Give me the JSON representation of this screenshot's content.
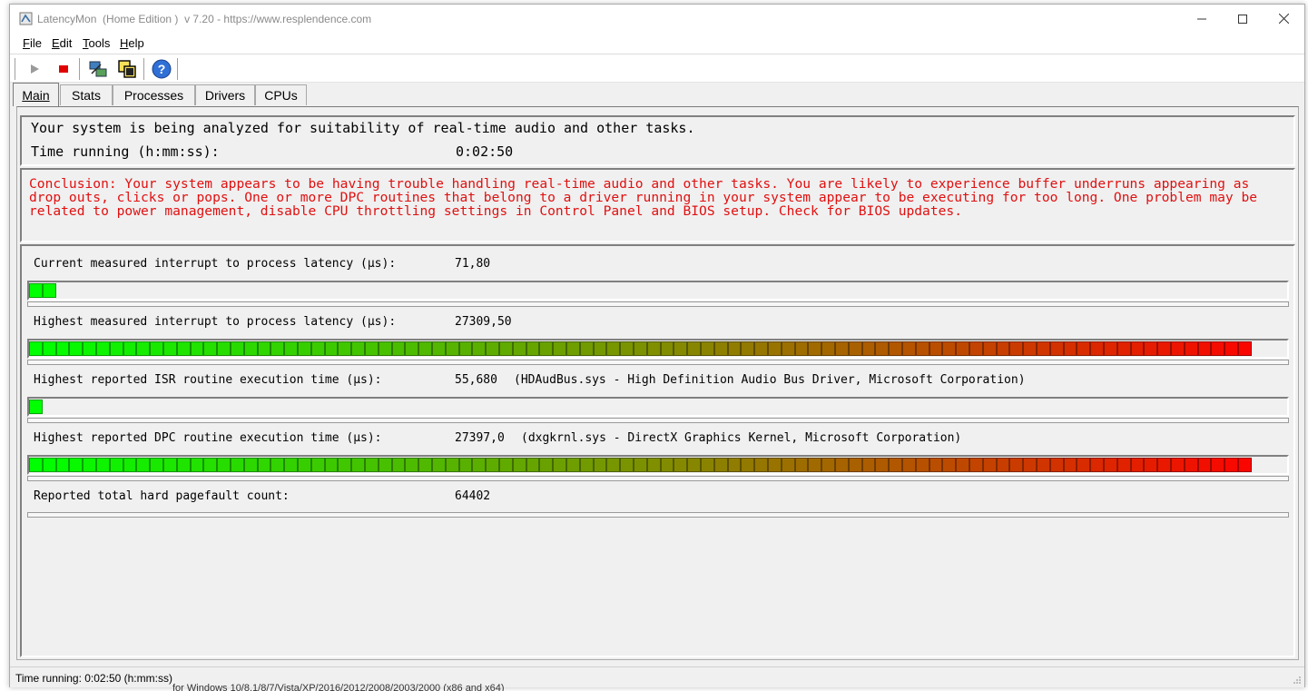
{
  "window": {
    "title": "LatencyMon  (Home Edition )  v 7.20 - https://www.resplendence.com"
  },
  "menu": {
    "file": "File",
    "edit": "Edit",
    "tools": "Tools",
    "help": "Help"
  },
  "toolbar": {
    "icons": [
      "play-icon",
      "stop-icon",
      "network-icon",
      "windows-icon",
      "help-icon"
    ]
  },
  "tabs": {
    "main": "Main",
    "stats": "Stats",
    "processes": "Processes",
    "drivers": "Drivers",
    "cpus": "CPUs"
  },
  "summary": {
    "analyzing_text": "Your system is being analyzed for suitability of real-time audio and other tasks.",
    "time_label": "Time running (h:mm:ss):",
    "time_value": "0:02:50"
  },
  "conclusion": {
    "text": "Conclusion: Your system appears to be having trouble handling real-time audio and other tasks. You are likely to experience buffer underruns appearing as drop outs, clicks or pops. One or more DPC routines that belong to a driver running in your system appear to be executing for too long. One problem may be related to power management, disable CPU throttling settings in Control Panel and BIOS setup. Check for BIOS updates.",
    "color": "#e01010"
  },
  "metrics": [
    {
      "label": "Current measured interrupt to process latency (µs):",
      "value": "71,80",
      "detail": "",
      "bar_fraction": 0.022
    },
    {
      "label": "Highest measured interrupt to process latency (µs):",
      "value": "27309,50",
      "detail": "",
      "bar_fraction": 0.98
    },
    {
      "label": "Highest reported ISR routine execution time (µs):",
      "value": "55,680",
      "detail": "(HDAudBus.sys - High Definition Audio Bus Driver, Microsoft Corporation)",
      "bar_fraction": 0.011
    },
    {
      "label": "Highest reported DPC routine execution time (µs):",
      "value": "27397,0",
      "detail": "(dxgkrnl.sys - DirectX Graphics Kernel, Microsoft Corporation)",
      "bar_fraction": 0.98
    },
    {
      "label": "Reported total hard pagefault count:",
      "value": "64402",
      "detail": "",
      "bar_fraction": null
    }
  ],
  "bar_colors": {
    "low": "#00ff00",
    "mid": "#7f8f00",
    "high": "#ff0000"
  },
  "statusbar": {
    "text": "Time running: 0:02:50  (h:mm:ss)"
  },
  "background_text": "for Windows 10/8.1/8/7/Vista/XP/2016/2012/2008/2003/2000 (x86 and x64)"
}
